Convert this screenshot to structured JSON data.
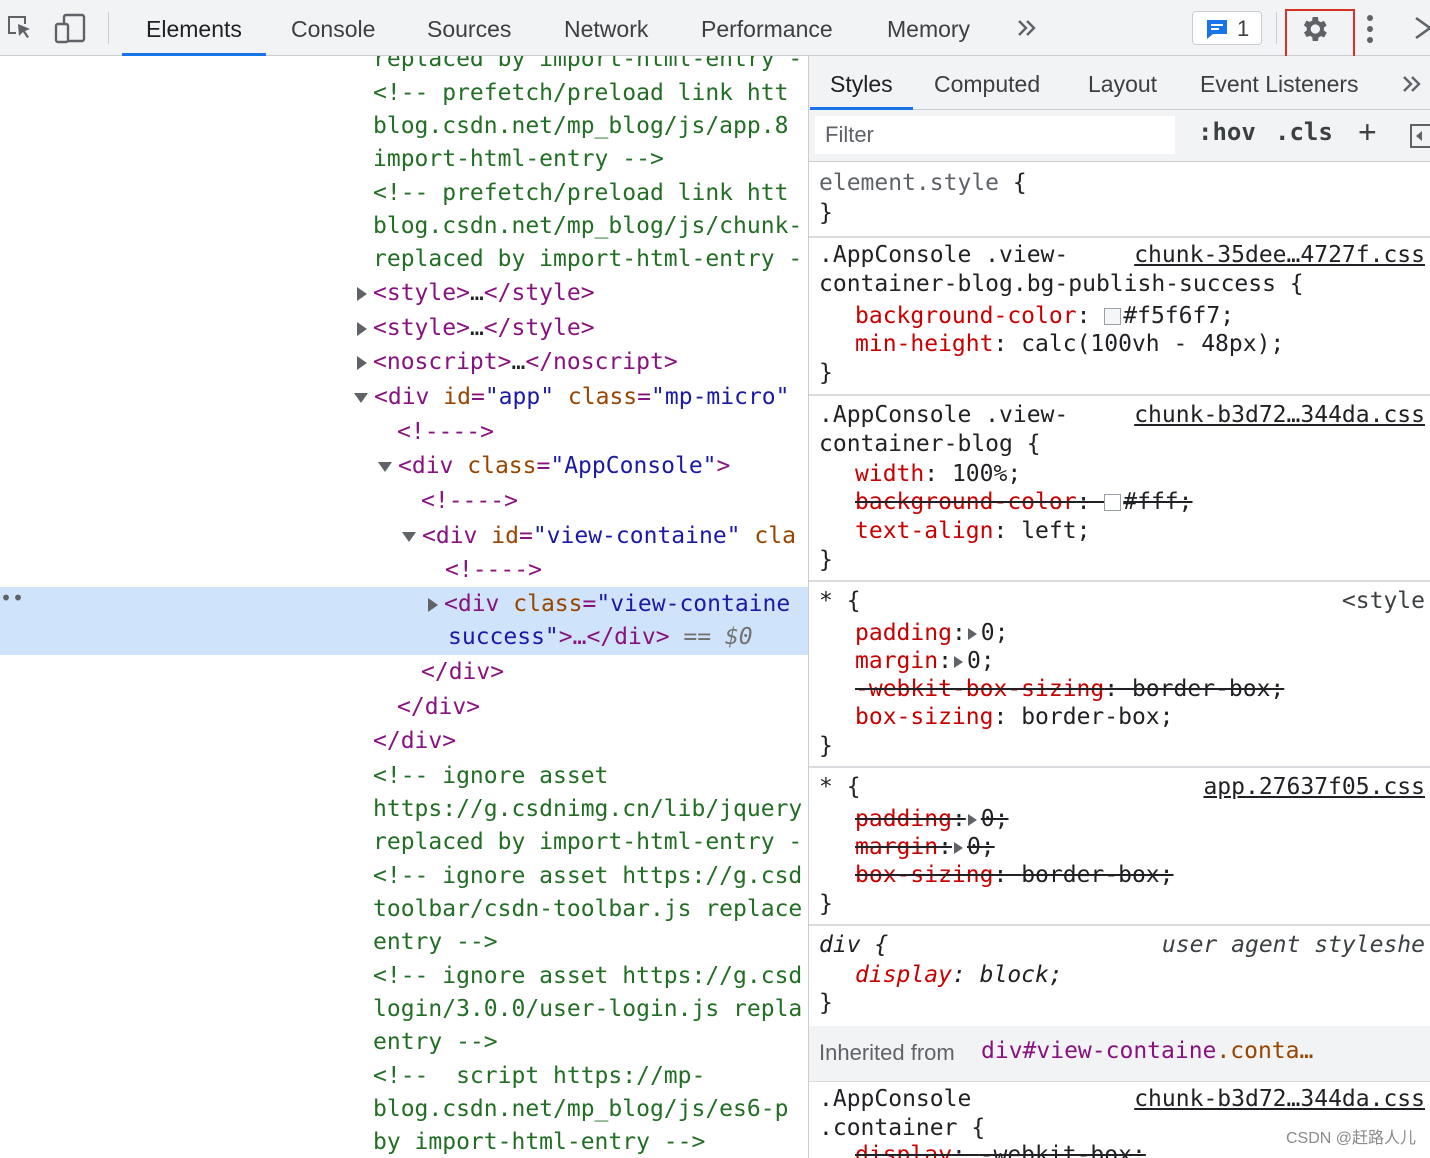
{
  "toolbar": {
    "tabs": [
      {
        "label": "Elements",
        "active": true
      },
      {
        "label": "Console"
      },
      {
        "label": "Sources"
      },
      {
        "label": "Network"
      },
      {
        "label": "Performance"
      },
      {
        "label": "Memory"
      }
    ],
    "more_tabs_icon": "chevron-double-right-icon",
    "issues_count": "1",
    "accent_color": "#1a73e8",
    "highlight_color": "#d93025"
  },
  "elements": {
    "lines": [
      {
        "text": "replaced by import-html-entry -"
      },
      {
        "text": "<!-- prefetch/preload link htt"
      },
      {
        "text": "blog.csdn.net/mp_blog/js/app.8"
      },
      {
        "text": "import-html-entry -->"
      },
      {
        "text": "<!-- prefetch/preload link htt"
      },
      {
        "text": "blog.csdn.net/mp_blog/js/chunk-"
      },
      {
        "text": "replaced by import-html-entry -"
      },
      {
        "tag_open": "<style>",
        "ellipsis": "…",
        "tag_close": "</style>"
      },
      {
        "tag_open": "<style>",
        "ellipsis": "…",
        "tag_close": "</style>"
      },
      {
        "tag_open": "<noscript>",
        "ellipsis": "…",
        "tag_close": "</noscript>"
      },
      {
        "tag": "<div",
        "attr1": "id",
        "val1": "\"app\"",
        "attr2": "class",
        "val2": "\"mp-micro\""
      },
      {
        "text": "<!---->"
      },
      {
        "tag": "<div",
        "attr1": "class",
        "val1": "\"AppConsole\"",
        "tag_end": ">"
      },
      {
        "text": "<!---->"
      },
      {
        "tag": "<div",
        "attr1": "id",
        "val1": "\"view-containe\"",
        "attr2": "cla"
      },
      {
        "text": "<!---->"
      },
      {
        "tag": "<div",
        "attr1": "class",
        "val1": "\"view-containe"
      },
      {
        "val_cont": "success\"",
        "tag_rest": ">…</div>",
        "eq": " == $0"
      },
      {
        "text": "</div>"
      },
      {
        "text": "</div>"
      },
      {
        "text": "</div>"
      },
      {
        "text": "<!-- ignore asset"
      },
      {
        "text": "https://g.csdnimg.cn/lib/jquery"
      },
      {
        "text": "replaced by import-html-entry -"
      },
      {
        "text": "<!-- ignore asset https://g.csd"
      },
      {
        "text": "toolbar/csdn-toolbar.js replace"
      },
      {
        "text": "entry -->"
      },
      {
        "text": "<!-- ignore asset https://g.csd"
      },
      {
        "text": "login/3.0.0/user-login.js repla"
      },
      {
        "text": "entry -->"
      },
      {
        "text": "<!--  script https://mp-"
      },
      {
        "text": "blog.csdn.net/mp_blog/js/es6-p"
      },
      {
        "text": "by import-html-entry -->"
      }
    ],
    "selected_dots": "••"
  },
  "styles": {
    "subtabs": [
      {
        "label": "Styles",
        "active": true
      },
      {
        "label": "Computed"
      },
      {
        "label": "Layout"
      },
      {
        "label": "Event Listeners"
      }
    ],
    "filter_placeholder": "Filter",
    "hov_label": ":hov",
    "cls_label": ".cls",
    "add_label": "+",
    "element_style": {
      "selector": "element.style",
      "open": " {",
      "close": "}"
    },
    "rule1": {
      "selector_1": ".AppConsole .view-",
      "selector_2": "container-blog.bg-publish-success {",
      "source": "chunk-35dee…4727f.css",
      "p1_name": "background-color",
      "p1_value": "#f5f6f7;",
      "p1_swatch": "#f5f6f7",
      "p2_name": "min-height",
      "p2_value": "calc(100vh - 48px);",
      "close": "}"
    },
    "rule2": {
      "selector_1": ".AppConsole .view-",
      "selector_2": "container-blog {",
      "source": "chunk-b3d72…344da.css",
      "p1_name": "width",
      "p1_value": "100%;",
      "p2_name": "background-color",
      "p2_value": "#fff;",
      "p2_swatch": "#ffffff",
      "p3_name": "text-align",
      "p3_value": "left;",
      "close": "}"
    },
    "rule3": {
      "selector": "* {",
      "source": "<style",
      "p1_name": "padding",
      "p1_value": "0;",
      "p2_name": "margin",
      "p2_value": "0;",
      "p3_name": "-webkit-box-sizing",
      "p3_value": "border-box;",
      "p4_name": "box-sizing",
      "p4_value": "border-box;",
      "close": "}"
    },
    "rule4": {
      "selector": "* {",
      "source": "app.27637f05.css",
      "p1_name": "padding",
      "p1_value": "0;",
      "p2_name": "margin",
      "p2_value": "0;",
      "p3_name": "box-sizing",
      "p3_value": "border-box;",
      "close": "}"
    },
    "rule5": {
      "selector": "div {",
      "source": "user agent styleshe",
      "p1_name": "display",
      "p1_value": "block;",
      "close": "}"
    },
    "inherited": {
      "label": "Inherited from",
      "tag": "div",
      "id": "#view-containe",
      "cls": ".conta…"
    },
    "rule6": {
      "selector_1": ".AppConsole",
      "selector_2": ".container {",
      "source": "chunk-b3d72…344da.css",
      "p1_name": "display",
      "p1_value": "-webkit-box;"
    }
  },
  "watermark": "CSDN @赶路人儿"
}
